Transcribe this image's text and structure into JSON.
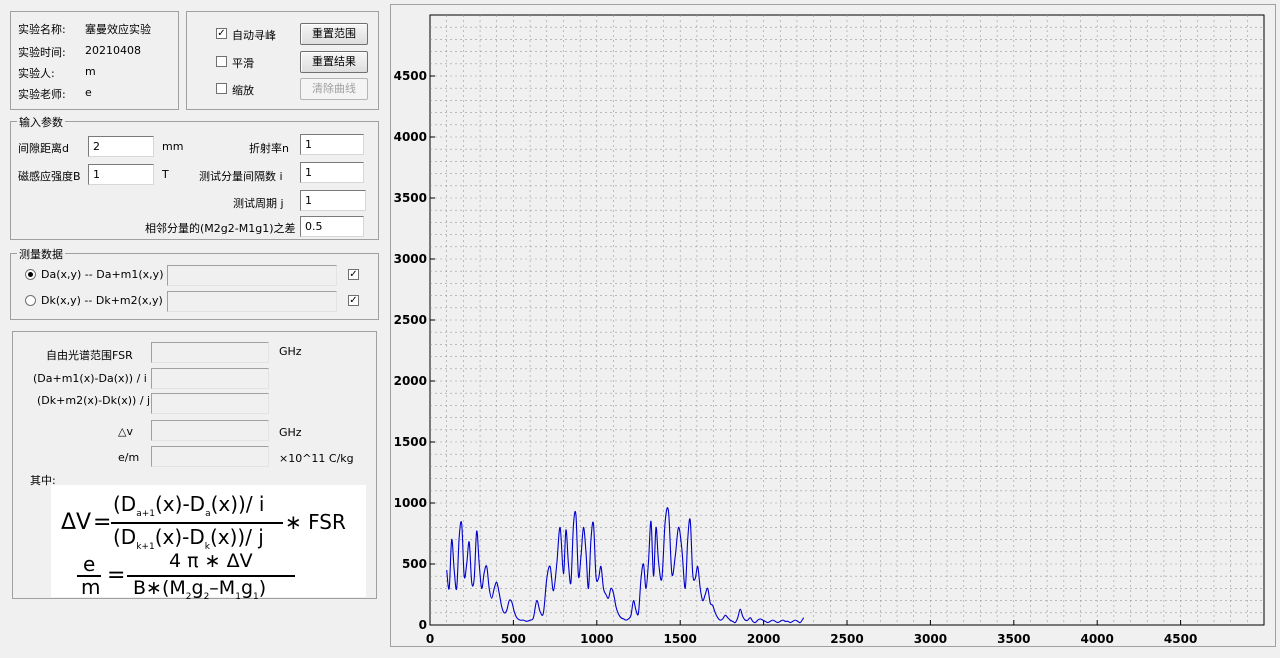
{
  "experiment": {
    "name_label": "实验名称:",
    "name_value": "塞曼效应实验",
    "time_label": "实验时间:",
    "time_value": "20210408",
    "person_label": "实验人:",
    "person_value": "m",
    "teacher_label": "实验老师:",
    "teacher_value": "e"
  },
  "options": {
    "auto_peak": {
      "label": "自动寻峰",
      "checked": true
    },
    "smooth": {
      "label": "平滑",
      "checked": false
    },
    "zoom": {
      "label": "缩放",
      "checked": false
    },
    "reset_range_label": "重置范围",
    "reset_result_label": "重置结果",
    "clear_curve_label": "清除曲线"
  },
  "input_params": {
    "title": "输入参数",
    "gap_label": "间隙距离d",
    "gap_value": "2",
    "gap_unit": "mm",
    "refractive_label": "折射率n",
    "refractive_value": "1",
    "field_label": "磁感应强度B",
    "field_value": "1",
    "field_unit": "T",
    "interval_label": "测试分量间隔数 i",
    "interval_value": "1",
    "period_label": "测试周期 j",
    "period_value": "1",
    "diff_label": "相邻分量的(M2g2-M1g1)之差",
    "diff_value": "0.5"
  },
  "measure": {
    "title": "测量数据",
    "row1_label": "Da(x,y) -- Da+m1(x,y)",
    "row1_selected": true,
    "row1_value": "",
    "row1_checked": true,
    "row2_label": "Dk(x,y) -- Dk+m2(x,y)",
    "row2_selected": false,
    "row2_value": "",
    "row2_checked": true
  },
  "results": {
    "fsr_label": "自由光谱范围FSR",
    "fsr_unit": "GHz",
    "da_label": "(Da+m1(x)-Da(x)) / i",
    "dk_label": "(Dk+m2(x)-Dk(x)) / j",
    "dv_label": "△v",
    "dv_unit": "GHz",
    "em_label": "e/m",
    "em_unit": "×10^11 C/kg",
    "where_label": "其中:"
  },
  "formula": {
    "delta_v": "ΔV",
    "eq": "=",
    "num1": "(D",
    "num1_sub": "a+1",
    "num1_rest": "(x)-D",
    "num1_sub2": "a",
    "num1_end": "(x))/ i",
    "den1": "(D",
    "den1_sub": "k+1",
    "den1_rest": "(x)-D",
    "den1_sub2": "k",
    "den1_end": "(x))/ j",
    "times_fsr": "∗ FSR",
    "e": "e",
    "m": "m",
    "num2": "4 π ∗ ΔV",
    "den2_a": "B∗(M",
    "den2_s1": "2",
    "den2_b": "g",
    "den2_s2": "2",
    "den2_c": "–M",
    "den2_s3": "1",
    "den2_d": "g",
    "den2_s4": "1",
    "den2_e": ")"
  },
  "chart_data": {
    "type": "line",
    "xlim": [
      0,
      5000
    ],
    "ylim": [
      0,
      5000
    ],
    "x_ticks": [
      0,
      500,
      1000,
      1500,
      2000,
      2500,
      3000,
      3500,
      4000,
      4500
    ],
    "y_ticks": [
      0,
      500,
      1000,
      1500,
      2000,
      2500,
      3000,
      3500,
      4000,
      4500
    ],
    "grid": true,
    "line_color": "#0000cc",
    "series": [
      {
        "x": [
          100,
          115,
          130,
          145,
          160,
          175,
          190,
          205,
          220,
          235,
          250,
          265,
          280,
          295,
          310,
          325,
          340,
          355,
          370,
          385,
          400,
          415,
          430,
          445,
          460,
          475,
          490,
          505,
          520,
          540,
          560,
          580,
          600,
          620,
          640,
          660,
          680,
          700,
          720,
          740,
          760,
          780,
          800,
          815,
          830,
          845,
          860,
          875,
          890,
          905,
          920,
          935,
          950,
          965,
          980,
          995,
          1010,
          1025,
          1040,
          1055,
          1070,
          1085,
          1100,
          1115,
          1130,
          1145,
          1160,
          1175,
          1190,
          1205,
          1220,
          1235,
          1250,
          1265,
          1280,
          1295,
          1310,
          1325,
          1340,
          1355,
          1370,
          1390,
          1410,
          1430,
          1450,
          1470,
          1490,
          1510,
          1530,
          1545,
          1560,
          1575,
          1590,
          1605,
          1620,
          1635,
          1650,
          1665,
          1680,
          1695,
          1710,
          1725,
          1740,
          1755,
          1770,
          1785,
          1800,
          1815,
          1830,
          1845,
          1860,
          1875,
          1890,
          1905,
          1920,
          1935,
          1950,
          1965,
          1980,
          1995,
          2010,
          2025,
          2040,
          2055,
          2070,
          2085,
          2100,
          2115,
          2130,
          2145,
          2160,
          2175,
          2190,
          2205,
          2220,
          2240
        ],
        "y": [
          450,
          300,
          700,
          450,
          300,
          720,
          830,
          400,
          500,
          680,
          350,
          380,
          770,
          500,
          300,
          430,
          480,
          300,
          220,
          300,
          350,
          260,
          150,
          100,
          120,
          200,
          190,
          110,
          60,
          40,
          40,
          30,
          40,
          60,
          200,
          110,
          100,
          380,
          480,
          280,
          500,
          800,
          420,
          780,
          500,
          350,
          820,
          900,
          400,
          560,
          800,
          600,
          300,
          700,
          830,
          400,
          380,
          480,
          300,
          250,
          220,
          300,
          260,
          150,
          90,
          60,
          50,
          40,
          50,
          80,
          200,
          120,
          100,
          380,
          500,
          300,
          520,
          850,
          400,
          800,
          520,
          380,
          850,
          930,
          420,
          560,
          800,
          620,
          300,
          700,
          860,
          420,
          380,
          480,
          300,
          200,
          250,
          300,
          180,
          160,
          100,
          60,
          40,
          50,
          80,
          60,
          40,
          30,
          20,
          60,
          130,
          70,
          40,
          40,
          60,
          30,
          20,
          40,
          50,
          40,
          30,
          20,
          30,
          40,
          30,
          20,
          30,
          40,
          30,
          30,
          20,
          30,
          40,
          30,
          20,
          60
        ],
        "name": ""
      }
    ]
  }
}
